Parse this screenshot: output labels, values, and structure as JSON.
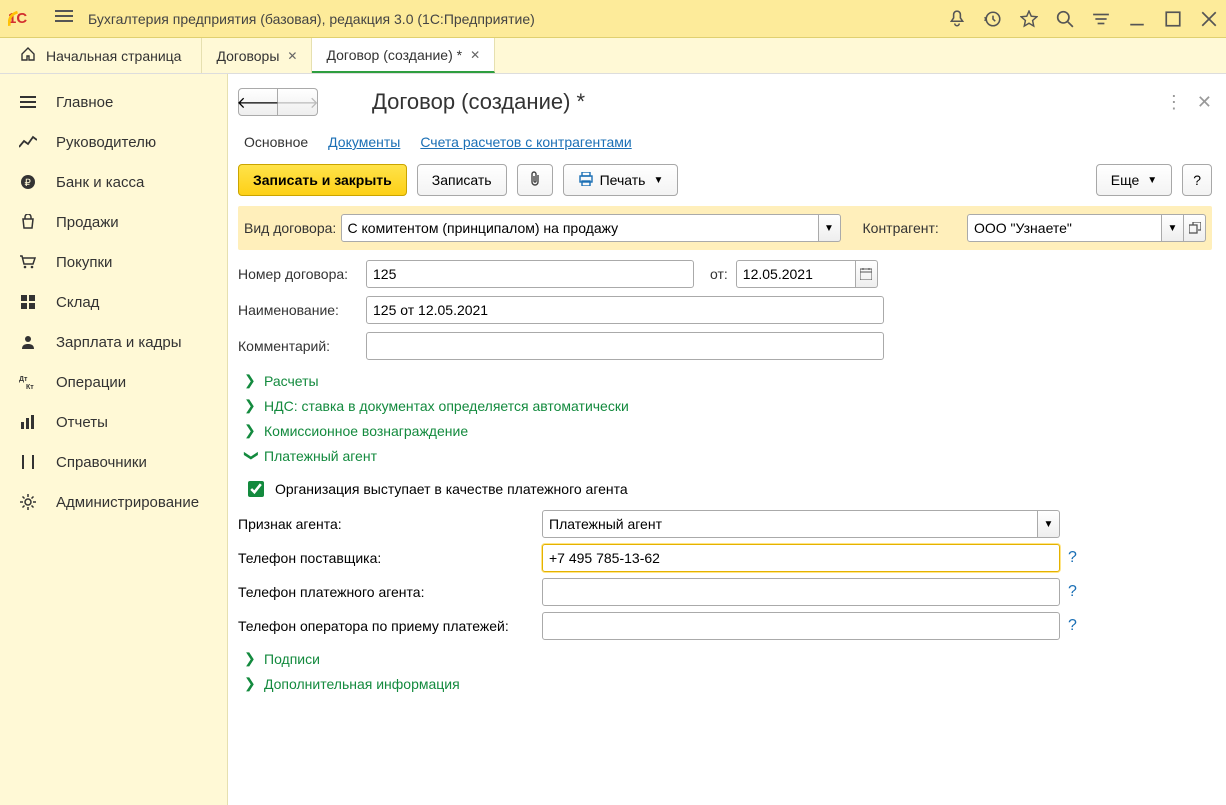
{
  "title": "Бухгалтерия предприятия (базовая), редакция 3.0  (1С:Предприятие)",
  "tabs": {
    "home": "Начальная страница",
    "t1": "Договоры",
    "t2": "Договор (создание) *"
  },
  "sidebar": [
    "Главное",
    "Руководителю",
    "Банк и касса",
    "Продажи",
    "Покупки",
    "Склад",
    "Зарплата и кадры",
    "Операции",
    "Отчеты",
    "Справочники",
    "Администрирование"
  ],
  "page": {
    "title": "Договор (создание) *",
    "subtabs": {
      "main": "Основное",
      "docs": "Документы",
      "accounts": "Счета расчетов с контрагентами"
    },
    "toolbar": {
      "save_close": "Записать и закрыть",
      "save": "Записать",
      "print": "Печать",
      "more": "Еще",
      "help": "?"
    },
    "labels": {
      "contract_type": "Вид договора:",
      "counterparty": "Контрагент:",
      "number": "Номер договора:",
      "from": "от:",
      "name": "Наименование:",
      "comment": "Комментарий:",
      "agent_sign": "Признак агента:",
      "supplier_phone": "Телефон поставщика:",
      "agent_phone": "Телефон платежного агента:",
      "operator_phone": "Телефон оператора по приему платежей:"
    },
    "values": {
      "contract_type": "С комитентом (принципалом) на продажу",
      "counterparty": "ООО \"Узнаете\"",
      "number": "125",
      "date": "12.05.2021",
      "name": "125 от 12.05.2021",
      "comment": "",
      "agent_sign": "Платежный агент",
      "supplier_phone": "+7 495 785-13-62",
      "agent_phone": "",
      "operator_phone": ""
    },
    "expanders": {
      "settlements": "Расчеты",
      "vat": "НДС: ставка в документах определяется автоматически",
      "commission": "Комиссионное вознаграждение",
      "payment_agent": "Платежный агент",
      "signatures": "Подписи",
      "extra": "Дополнительная информация"
    },
    "checkbox": "Организация выступает в качестве платежного агента"
  }
}
